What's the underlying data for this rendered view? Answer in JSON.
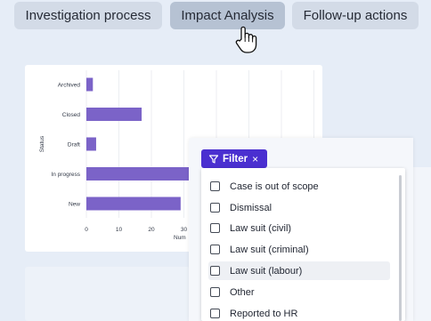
{
  "tabs": [
    {
      "label": "Investigation process",
      "active": false
    },
    {
      "label": "Impact Analysis",
      "active": true
    },
    {
      "label": "Follow-up actions",
      "active": false
    }
  ],
  "chart_data": {
    "type": "bar",
    "orientation": "horizontal",
    "categories": [
      "Archived",
      "Closed",
      "Draft",
      "In progress",
      "New"
    ],
    "values": [
      2,
      17,
      3,
      39,
      29
    ],
    "ylabel": "Status",
    "xlabel_partial": "Num",
    "x_ticks": [
      "0",
      "10",
      "20",
      "30"
    ],
    "bar_color": "#7b63c8",
    "grid": true
  },
  "filter": {
    "chip_label": "Filter",
    "chip_close": "×",
    "options": [
      {
        "label": "Case is out of scope",
        "checked": false
      },
      {
        "label": "Dismissal",
        "checked": false
      },
      {
        "label": "Law suit (civil)",
        "checked": false
      },
      {
        "label": "Law suit (criminal)",
        "checked": false
      },
      {
        "label": "Law suit (labour)",
        "checked": false,
        "hovered": true
      },
      {
        "label": "Other",
        "checked": false
      },
      {
        "label": "Reported to HR",
        "checked": false
      }
    ]
  },
  "colors": {
    "background": "#e6edf7",
    "tab": "#d3dbe7",
    "tab_active": "#b6c2d3",
    "accent": "#4a2fd0"
  }
}
